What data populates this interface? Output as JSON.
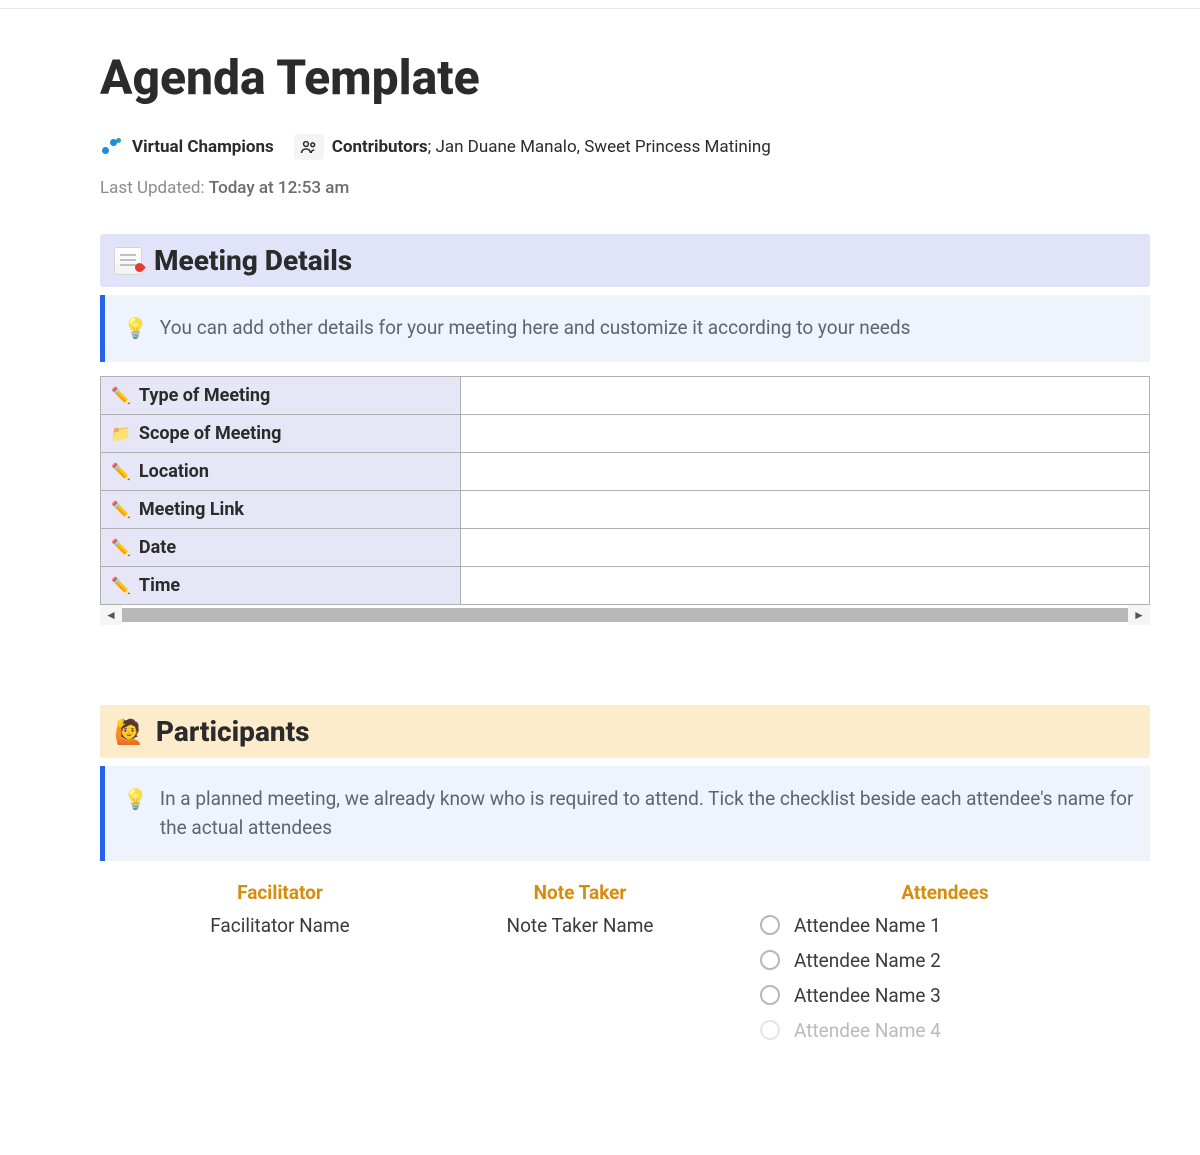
{
  "page": {
    "title": "Agenda Template",
    "organization": "Virtual Champions",
    "contributors_label": "Contributors",
    "contributors": "Jan Duane Manalo, Sweet Princess Matining",
    "last_updated_label": "Last Updated:",
    "last_updated_value": "Today at 12:53 am"
  },
  "meeting_details": {
    "title": "Meeting Details",
    "callout": "You can add other details for your meeting here and customize it according to your needs",
    "rows": [
      {
        "label": "Type of Meeting",
        "value": "",
        "icon": "edit"
      },
      {
        "label": "Scope of Meeting",
        "value": "",
        "icon": "folder"
      },
      {
        "label": "Location",
        "value": "",
        "icon": "edit"
      },
      {
        "label": "Meeting Link",
        "value": "",
        "icon": "edit"
      },
      {
        "label": "Date",
        "value": "",
        "icon": "edit"
      },
      {
        "label": "Time",
        "value": "",
        "icon": "edit"
      }
    ]
  },
  "participants": {
    "title": "Participants",
    "callout": "In a planned meeting, we already know who is required to attend. Tick the checklist beside each attendee's name for the actual attendees",
    "facilitator_label": "Facilitator",
    "facilitator_value": "Facilitator Name",
    "note_taker_label": "Note Taker",
    "note_taker_value": "Note Taker Name",
    "attendees_label": "Attendees",
    "attendees": [
      "Attendee Name 1",
      "Attendee Name 2",
      "Attendee Name 3",
      "Attendee Name 4"
    ]
  }
}
